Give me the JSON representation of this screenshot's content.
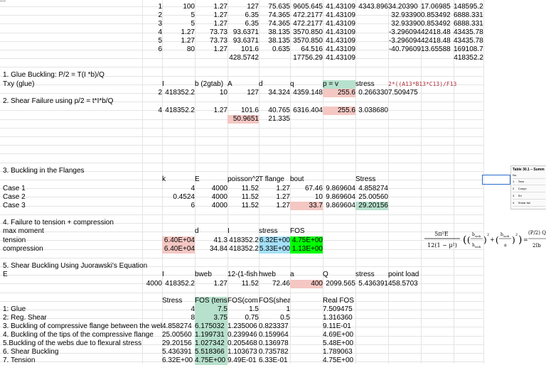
{
  "colors": {
    "pink": "#f4c7c3",
    "green": "#b7e1cd",
    "bright_green": "#00ff00",
    "cyan": "#a4e0f7",
    "gridline": "#e4e4e4",
    "formula_red": "#b0303a"
  },
  "cells": [
    {
      "id": "r0c0",
      "text": "..."
    },
    {
      "id": "t1",
      "text": "1"
    },
    {
      "id": "t1a",
      "text": "100"
    },
    {
      "id": "t1b",
      "text": "1.27"
    },
    {
      "id": "t1c",
      "text": "127"
    },
    {
      "id": "t1d",
      "text": "75.635"
    },
    {
      "id": "t1e",
      "text": "9605.645"
    },
    {
      "id": "t1f",
      "text": "41.43109"
    },
    {
      "id": "t1g",
      "text": "4343.896"
    },
    {
      "id": "t1h",
      "text": "34.20390"
    },
    {
      "id": "t1i",
      "text": "17.06985"
    },
    {
      "id": "t1j",
      "text": "148595.2"
    },
    {
      "id": "t2",
      "text": "2"
    },
    {
      "id": "t2a",
      "text": "5"
    },
    {
      "id": "t2b",
      "text": "1.27"
    },
    {
      "id": "t2c",
      "text": "6.35"
    },
    {
      "id": "t2d",
      "text": "74.365"
    },
    {
      "id": "t2e",
      "text": "472.2177"
    },
    {
      "id": "t2f",
      "text": "41.43109"
    },
    {
      "id": "t2h",
      "text": "32.93390"
    },
    {
      "id": "t2i",
      "text": "0.853492"
    },
    {
      "id": "t2j",
      "text": "6888.331"
    },
    {
      "id": "t3",
      "text": "3"
    },
    {
      "id": "t3a",
      "text": "5"
    },
    {
      "id": "t3b",
      "text": "1.27"
    },
    {
      "id": "t3c",
      "text": "6.35"
    },
    {
      "id": "t3d",
      "text": "74.365"
    },
    {
      "id": "t3e",
      "text": "472.2177"
    },
    {
      "id": "t3f",
      "text": "41.43109"
    },
    {
      "id": "t3h",
      "text": "32.93390"
    },
    {
      "id": "t3i",
      "text": "0.853492"
    },
    {
      "id": "t3j",
      "text": "6888.331"
    },
    {
      "id": "t4",
      "text": "4"
    },
    {
      "id": "t4a",
      "text": "1.27"
    },
    {
      "id": "t4b",
      "text": "73.73"
    },
    {
      "id": "t4c",
      "text": "93.6371"
    },
    {
      "id": "t4d",
      "text": "38.135"
    },
    {
      "id": "t4e",
      "text": "3570.850"
    },
    {
      "id": "t4f",
      "text": "41.43109"
    },
    {
      "id": "t4h",
      "text": "-3.296094"
    },
    {
      "id": "t4i",
      "text": "42418.48"
    },
    {
      "id": "t4j",
      "text": "43435.78"
    },
    {
      "id": "t5",
      "text": "5"
    },
    {
      "id": "t5a",
      "text": "1.27"
    },
    {
      "id": "t5b",
      "text": "73.73"
    },
    {
      "id": "t5c",
      "text": "93.6371"
    },
    {
      "id": "t5d",
      "text": "38.135"
    },
    {
      "id": "t5e",
      "text": "3570.850"
    },
    {
      "id": "t5f",
      "text": "41.43109"
    },
    {
      "id": "t5h",
      "text": "-3.296094"
    },
    {
      "id": "t5i",
      "text": "42418.48"
    },
    {
      "id": "t5j",
      "text": "43435.78"
    },
    {
      "id": "t6",
      "text": "6"
    },
    {
      "id": "t6a",
      "text": "80"
    },
    {
      "id": "t6b",
      "text": "1.27"
    },
    {
      "id": "t6c",
      "text": "101.6"
    },
    {
      "id": "t6d",
      "text": "0.635"
    },
    {
      "id": "t6e",
      "text": "64.516"
    },
    {
      "id": "t6f",
      "text": "41.43109"
    },
    {
      "id": "t6h",
      "text": "-40.79609"
    },
    {
      "id": "t6i",
      "text": "13.65588"
    },
    {
      "id": "t6j",
      "text": "169108.7"
    },
    {
      "id": "t7c",
      "text": "428.5742"
    },
    {
      "id": "t7e",
      "text": "17756.29"
    },
    {
      "id": "t7f",
      "text": "41.43109"
    },
    {
      "id": "t7j",
      "text": "418352.2"
    },
    {
      "id": "s1",
      "text": "1. Glue Buckling: P/2 = T(I *b)/Q"
    },
    {
      "id": "s1r1a",
      "text": "Txy (glue)"
    },
    {
      "id": "s1r1b",
      "text": "I"
    },
    {
      "id": "s1r1c",
      "text": "b (2gtab)"
    },
    {
      "id": "s1r1d",
      "text": "A"
    },
    {
      "id": "s1r1e",
      "text": "d"
    },
    {
      "id": "s1r1f",
      "text": "q"
    },
    {
      "id": "s1r1g",
      "text": "p = v"
    },
    {
      "id": "s1r1h",
      "text": "stress"
    },
    {
      "id": "s1r1i",
      "text": "2*((A13*B13*C13)/F13"
    },
    {
      "id": "s1r2a",
      "text": "2"
    },
    {
      "id": "s1r2b",
      "text": "418352.2"
    },
    {
      "id": "s1r2c",
      "text": "10"
    },
    {
      "id": "s1r2d",
      "text": "127"
    },
    {
      "id": "s1r2e",
      "text": "34.324"
    },
    {
      "id": "s1r2f",
      "text": "4359.148"
    },
    {
      "id": "s1r2g",
      "text": "255.6"
    },
    {
      "id": "s1r2h",
      "text": "0.266330"
    },
    {
      "id": "s1r2i",
      "text": "7.509475"
    },
    {
      "id": "s2",
      "text": "2. Shear Failure using p/2 = t*I*b/Q"
    },
    {
      "id": "s2r1a",
      "text": "4"
    },
    {
      "id": "s2r1b",
      "text": "418352.2"
    },
    {
      "id": "s2r1c",
      "text": "1.27"
    },
    {
      "id": "s2r1d",
      "text": "101.6"
    },
    {
      "id": "s2r1e",
      "text": "40.765"
    },
    {
      "id": "s2r1f",
      "text": "6316.404"
    },
    {
      "id": "s2r1g",
      "text": "255.6"
    },
    {
      "id": "s2r1h",
      "text": "3.038680"
    },
    {
      "id": "s2r2d",
      "text": "50.9651"
    },
    {
      "id": "s2r2e",
      "text": "21.335"
    },
    {
      "id": "s3",
      "text": "3. Buckling in the Flanges"
    },
    {
      "id": "s3h1",
      "text": "k"
    },
    {
      "id": "s3h2",
      "text": "E"
    },
    {
      "id": "s3h3",
      "text": "poisson^2"
    },
    {
      "id": "s3h4",
      "text": "T flange"
    },
    {
      "id": "s3h5",
      "text": "bout"
    },
    {
      "id": "s3h6",
      "text": "Stress"
    },
    {
      "id": "s3c1",
      "text": "Case 1"
    },
    {
      "id": "s3c1a",
      "text": "4"
    },
    {
      "id": "s3c1b",
      "text": "4000"
    },
    {
      "id": "s3c1c",
      "text": "11.52"
    },
    {
      "id": "s3c1d",
      "text": "1.27"
    },
    {
      "id": "s3c1e",
      "text": "67.46"
    },
    {
      "id": "s3c1f",
      "text": "9.869604"
    },
    {
      "id": "s3c1g",
      "text": "4.858274"
    },
    {
      "id": "s3c2",
      "text": "Case 2"
    },
    {
      "id": "s3c2a",
      "text": "0.4524"
    },
    {
      "id": "s3c2b",
      "text": "4000"
    },
    {
      "id": "s3c2c",
      "text": "11.52"
    },
    {
      "id": "s3c2d",
      "text": "1.27"
    },
    {
      "id": "s3c2e",
      "text": "10"
    },
    {
      "id": "s3c2f",
      "text": "9.869604"
    },
    {
      "id": "s3c2g",
      "text": "25.00560"
    },
    {
      "id": "s3c3",
      "text": "Case 3"
    },
    {
      "id": "s3c3a",
      "text": "6"
    },
    {
      "id": "s3c3b",
      "text": "4000"
    },
    {
      "id": "s3c3c",
      "text": "11.52"
    },
    {
      "id": "s3c3d",
      "text": "1.27"
    },
    {
      "id": "s3c3e",
      "text": "33.7"
    },
    {
      "id": "s3c3f",
      "text": "9.869604"
    },
    {
      "id": "s3c3g",
      "text": "29.20156"
    },
    {
      "id": "s4",
      "text": "4. Failure to tension + compression"
    },
    {
      "id": "s4h0",
      "text": "max moment"
    },
    {
      "id": "s4h1",
      "text": "d"
    },
    {
      "id": "s4h2",
      "text": "I"
    },
    {
      "id": "s4h3",
      "text": "stress"
    },
    {
      "id": "s4h4",
      "text": "FOS"
    },
    {
      "id": "s4r1",
      "text": "tension"
    },
    {
      "id": "s4r1a",
      "text": "6.40E+04"
    },
    {
      "id": "s4r1b",
      "text": "41.3"
    },
    {
      "id": "s4r1c",
      "text": "418352.2"
    },
    {
      "id": "s4r1d",
      "text": "6.32E+00"
    },
    {
      "id": "s4r1e",
      "text": "4.75E+00"
    },
    {
      "id": "s4r2",
      "text": "compression"
    },
    {
      "id": "s4r2a",
      "text": "6.40E+04"
    },
    {
      "id": "s4r2b",
      "text": "34.84"
    },
    {
      "id": "s4r2c",
      "text": "418352.2"
    },
    {
      "id": "s4r2d",
      "text": "5.33E+00"
    },
    {
      "id": "s4r2e",
      "text": "1.13E+00"
    },
    {
      "id": "s5",
      "text": "5. Shear Buckling Using Juorawski's Equation"
    },
    {
      "id": "s5h0",
      "text": "E"
    },
    {
      "id": "s5h1",
      "text": "I"
    },
    {
      "id": "s5h2",
      "text": "bweb"
    },
    {
      "id": "s5h3",
      "text": "12-(1-fish"
    },
    {
      "id": "s5h4",
      "text": "hweb"
    },
    {
      "id": "s5h5",
      "text": "a"
    },
    {
      "id": "s5h6",
      "text": "Q"
    },
    {
      "id": "s5h7",
      "text": "stress"
    },
    {
      "id": "s5h8",
      "text": "point load"
    },
    {
      "id": "s5r1a",
      "text": "4000"
    },
    {
      "id": "s5r1b",
      "text": "418352.2"
    },
    {
      "id": "s5r1c",
      "text": "1.27"
    },
    {
      "id": "s5r1d",
      "text": "11.52"
    },
    {
      "id": "s5r1e",
      "text": "72.46"
    },
    {
      "id": "s5r1f",
      "text": "400"
    },
    {
      "id": "s5r1g",
      "text": "2099.565"
    },
    {
      "id": "s5r1h",
      "text": "5.436391"
    },
    {
      "id": "s5r1i",
      "text": "458.5703"
    },
    {
      "id": "sth1",
      "text": "Stress"
    },
    {
      "id": "sth2",
      "text": "FOS (tens"
    },
    {
      "id": "sth3",
      "text": "FOS(com"
    },
    {
      "id": "sth4",
      "text": "FOS(shear)"
    },
    {
      "id": "sth5",
      "text": "Real FOS"
    },
    {
      "id": "sr1",
      "text": "1: Glue"
    },
    {
      "id": "sr1a",
      "text": "4"
    },
    {
      "id": "sr1b",
      "text": "7.5"
    },
    {
      "id": "sr1c",
      "text": "1.5"
    },
    {
      "id": "sr1d",
      "text": "1"
    },
    {
      "id": "sr1e",
      "text": "7.509475"
    },
    {
      "id": "sr2",
      "text": "2: Reg. Shear"
    },
    {
      "id": "sr2a",
      "text": "8"
    },
    {
      "id": "sr2b",
      "text": "3.75"
    },
    {
      "id": "sr2c",
      "text": "0.75"
    },
    {
      "id": "sr2d",
      "text": "0.5"
    },
    {
      "id": "sr2e",
      "text": "1.316360"
    },
    {
      "id": "sr3",
      "text": "3. Buckling of compressive flange between the webs"
    },
    {
      "id": "sr3a",
      "text": "4.858274"
    },
    {
      "id": "sr3b",
      "text": "6.175032"
    },
    {
      "id": "sr3c",
      "text": "1.235006"
    },
    {
      "id": "sr3d",
      "text": "0.823337"
    },
    {
      "id": "sr3e",
      "text": "9.11E-01"
    },
    {
      "id": "sr4",
      "text": "4. Buckling of the tips of the compressive flange"
    },
    {
      "id": "sr4a",
      "text": "25.00560"
    },
    {
      "id": "sr4b",
      "text": "1.199731"
    },
    {
      "id": "sr4c",
      "text": "0.239946"
    },
    {
      "id": "sr4d",
      "text": "0.159964"
    },
    {
      "id": "sr4e",
      "text": "4.69E+00"
    },
    {
      "id": "sr5",
      "text": "5.Buckling of the webs due to flexural stress"
    },
    {
      "id": "sr5a",
      "text": "29.20156"
    },
    {
      "id": "sr5b",
      "text": "1.027342"
    },
    {
      "id": "sr5c",
      "text": "0.205468"
    },
    {
      "id": "sr5d",
      "text": "0.136978"
    },
    {
      "id": "sr5e",
      "text": "5.48E+00"
    },
    {
      "id": "sr6",
      "text": "6. Shear Buckling"
    },
    {
      "id": "sr6a",
      "text": "5.436391"
    },
    {
      "id": "sr6b",
      "text": "5.518366"
    },
    {
      "id": "sr6c",
      "text": "1.103673"
    },
    {
      "id": "sr6d",
      "text": "0.735782"
    },
    {
      "id": "sr6e",
      "text": "1.789063"
    },
    {
      "id": "sr7",
      "text": "7. Tension"
    },
    {
      "id": "sr7a",
      "text": "6.32E+00"
    },
    {
      "id": "sr7b",
      "text": "4.75E+00"
    },
    {
      "id": "sr7c",
      "text": "9.49E-01"
    },
    {
      "id": "sr7d",
      "text": "6.33E-01"
    },
    {
      "id": "sr7e",
      "text": "4.75E+00"
    }
  ],
  "thumbnail": {
    "title": "Table 30.1 – Summ",
    "col": "No.",
    "rows": [
      "1",
      "2",
      "3",
      "4"
    ],
    "texts": [
      "Tens",
      "Compr",
      "Sh",
      "Shear fail"
    ]
  },
  "equation": {
    "lhs_num": "5π²E",
    "lhs_den": "12(1 − μ²)",
    "rhs_den": "2Ib"
  }
}
